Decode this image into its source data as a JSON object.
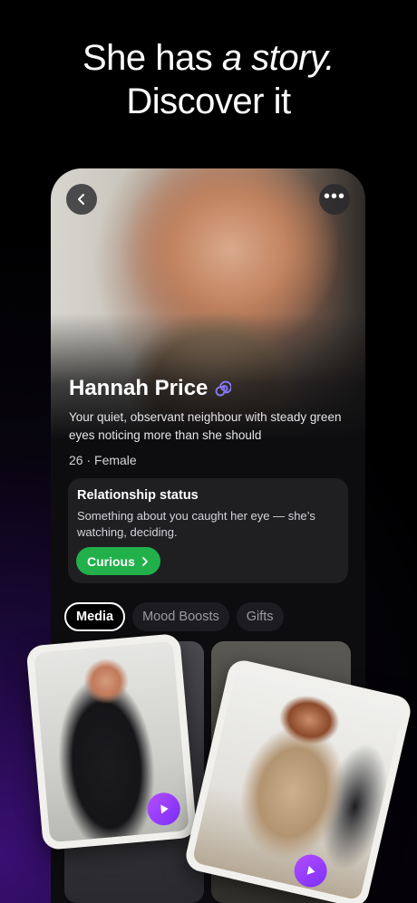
{
  "headline": {
    "line1_plain": "She has ",
    "line1_italic": "a story.",
    "line2": "Discover it"
  },
  "profile": {
    "name": "Hannah Price",
    "bio": "Your quiet, observant neighbour with steady green eyes noticing more than she should",
    "meta": "26 · Female",
    "verified_icon": "spiral-badge-icon"
  },
  "relationship": {
    "title": "Relationship status",
    "text": "Something about you caught her eye — she’s watching, deciding.",
    "button_label": "Curious",
    "button_color": "#22b04b"
  },
  "tabs": [
    {
      "label": "Media",
      "active": true
    },
    {
      "label": "Mood Boosts",
      "active": false
    },
    {
      "label": "Gifts",
      "active": false
    }
  ],
  "colors": {
    "accent": "#8b4dff",
    "background_glow": "#3a0f73"
  },
  "icons": {
    "back": "chevron-left-icon",
    "more": "more-dots-icon",
    "play": "play-icon"
  }
}
